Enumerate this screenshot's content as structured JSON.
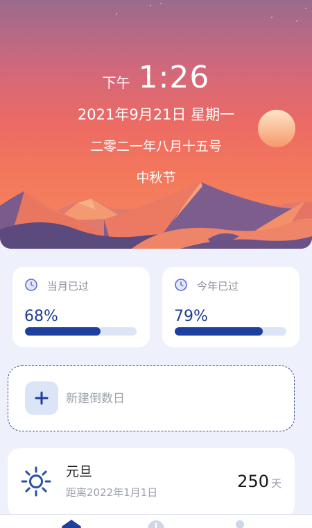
{
  "hero": {
    "ampm": "下午",
    "time": "1:26",
    "date": "2021年9月21日 星期一",
    "lunar_date": "二零二一年八月十五号",
    "festival": "中秋节"
  },
  "stats": [
    {
      "icon": "clock-icon",
      "label": "当月已过",
      "value_text": "68%",
      "progress": 0.68
    },
    {
      "icon": "clock-icon",
      "label": "今年已过",
      "value_text": "79%",
      "progress": 0.79
    }
  ],
  "new_countdown": {
    "icon": "plus-icon",
    "label": "新建倒数日"
  },
  "countdowns": [
    {
      "icon": "sun-icon",
      "title": "元旦",
      "subtitle": "距离2022年1月1日",
      "days": "250",
      "unit": "天"
    }
  ],
  "bottom_nav": [
    {
      "icon": "home-icon",
      "active": true
    },
    {
      "icon": "clock-icon",
      "active": false
    },
    {
      "icon": "user-icon",
      "active": false
    }
  ],
  "colors": {
    "accent": "#1d3f9e",
    "page_background": "#eef0fb",
    "progress_track": "#dde4f6",
    "muted_text": "#9a9fab"
  }
}
